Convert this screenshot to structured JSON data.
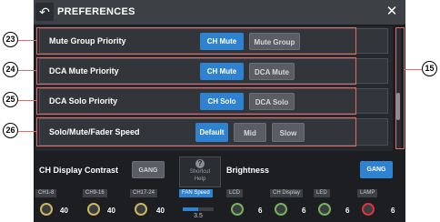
{
  "window": {
    "title": "PREFERENCES",
    "back_icon": "↶",
    "close_icon": "✕"
  },
  "rows": [
    {
      "label": "Mute Group Priority",
      "buttons": [
        "CH Mute",
        "Mute Group"
      ],
      "selected": 0
    },
    {
      "label": "DCA Mute Priority",
      "buttons": [
        "CH Mute",
        "DCA Mute"
      ],
      "selected": 0
    },
    {
      "label": "DCA Solo Priority",
      "buttons": [
        "CH Solo",
        "DCA Solo"
      ],
      "selected": 0
    },
    {
      "label": "Solo/Mute/Fader Speed",
      "buttons": [
        "Default",
        "Mid",
        "Slow"
      ],
      "selected": 0
    }
  ],
  "bottom": {
    "ch_display_contrast": "CH Display Contrast",
    "gang": "GANG",
    "shortcut_help": [
      "Shortcut",
      "Help"
    ],
    "brightness": "Brightness",
    "contrast_knobs": [
      {
        "label": "CH1-8",
        "value": "40"
      },
      {
        "label": "CH9-16",
        "value": "40"
      },
      {
        "label": "CH17-24",
        "value": "40"
      }
    ],
    "fan_speed": {
      "label": "FAN Speed",
      "value": "3.5",
      "level": 0.5
    },
    "brightness_knobs": [
      {
        "label": "LCD",
        "value": "6"
      },
      {
        "label": "CH Display",
        "value": "6"
      },
      {
        "label": "LED",
        "value": "6"
      },
      {
        "label": "LAMP",
        "value": "6"
      }
    ]
  },
  "callouts": [
    "23",
    "24",
    "25",
    "26",
    "15"
  ],
  "colors": {
    "accent": "#2f82d0",
    "callout_outline": "#e06c65"
  }
}
